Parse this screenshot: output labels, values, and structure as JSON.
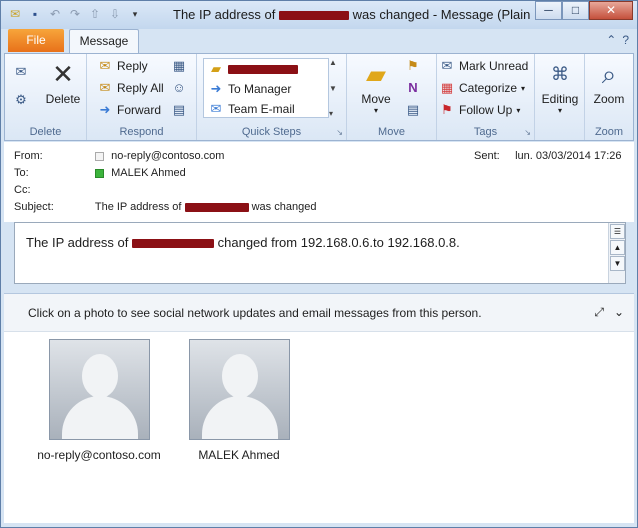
{
  "window": {
    "title_prefix": "The IP address of",
    "title_suffix": "was changed  -  Message (Plain",
    "minimize": "─",
    "maximize": "□",
    "close": "✕"
  },
  "tabs": {
    "file": "File",
    "message": "Message"
  },
  "ribbon": {
    "delete_group": {
      "delete": "Delete",
      "label": "Delete"
    },
    "respond": {
      "reply": "Reply",
      "reply_all": "Reply All",
      "forward": "Forward",
      "label": "Respond"
    },
    "quick_steps": {
      "to_manager": "To Manager",
      "team_email": "Team E-mail",
      "label": "Quick Steps"
    },
    "move": {
      "move": "Move",
      "label": "Move"
    },
    "tags": {
      "mark_unread": "Mark Unread",
      "categorize": "Categorize",
      "follow_up": "Follow Up",
      "label": "Tags"
    },
    "editing": {
      "editing": "Editing"
    },
    "zoom": {
      "zoom": "Zoom",
      "label": "Zoom"
    }
  },
  "header": {
    "from_label": "From:",
    "from_value": "no-reply@contoso.com",
    "to_label": "To:",
    "to_value": "MALEK Ahmed",
    "cc_label": "Cc:",
    "subject_label": "Subject:",
    "subject_prefix": "The IP address of",
    "subject_suffix": "was changed",
    "sent_label": "Sent:",
    "sent_value": "lun. 03/03/2014 17:26"
  },
  "body": {
    "prefix": "The IP address of",
    "suffix": "changed from 192.168.0.6.to 192.168.0.8."
  },
  "social": {
    "prompt": "Click on a photo to see social network updates and email messages from this person.",
    "people": [
      {
        "name": "no-reply@contoso.com"
      },
      {
        "name": "MALEK Ahmed"
      }
    ]
  },
  "colors": {
    "file_tab": "#e8711a",
    "redaction": "#8b1015",
    "accent": "#3b5a86"
  }
}
